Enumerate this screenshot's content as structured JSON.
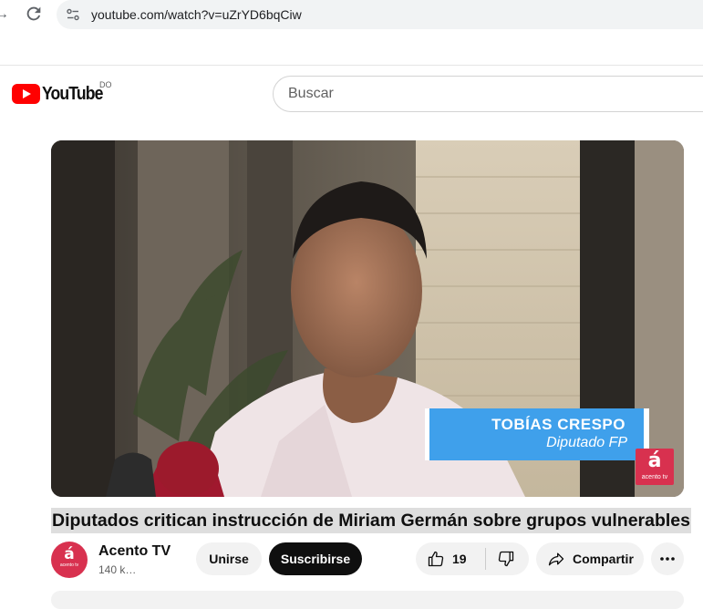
{
  "browser": {
    "url": "youtube.com/watch?v=uZrYD6bqCiw"
  },
  "header": {
    "logo_text": "YouTube",
    "country_code": "DO",
    "search_placeholder": "Buscar"
  },
  "video": {
    "overlay_name": "TOBÍAS CRESPO",
    "overlay_role": "Diputado FP",
    "watermark_glyph": "á",
    "watermark_sub": "acento tv"
  },
  "title": "Diputados critican instrucción de Miriam Germán sobre grupos vulnerables",
  "channel": {
    "name": "Acento TV",
    "subscribers": "140 k…",
    "avatar_glyph": "á",
    "avatar_sub": "acento tv"
  },
  "actions": {
    "join_label": "Unirse",
    "subscribe_label": "Suscribirse",
    "like_count": "19",
    "share_label": "Compartir"
  },
  "colors": {
    "brand_red": "#ff0000",
    "acento_red": "#d8314f",
    "lower_third_blue": "#3fa0eb"
  }
}
